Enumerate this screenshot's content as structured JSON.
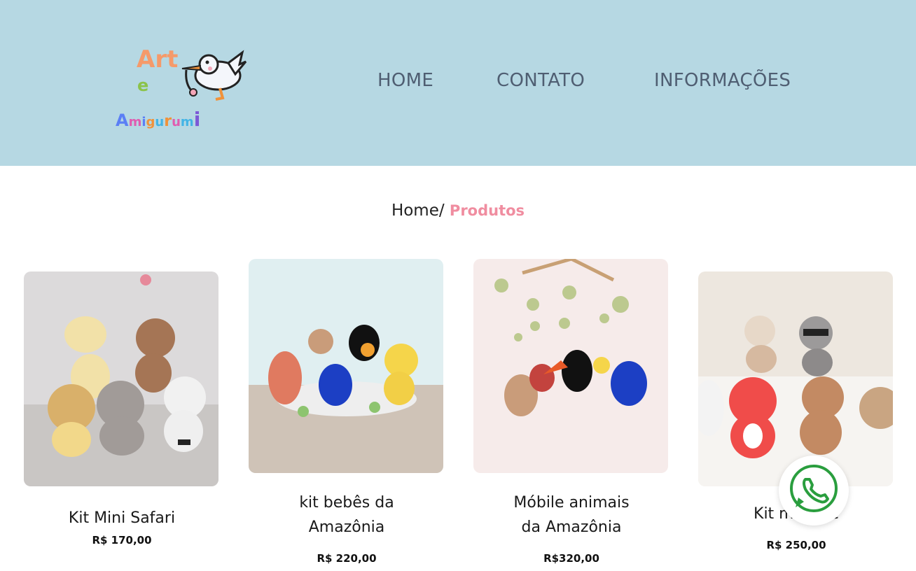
{
  "logo": {
    "text": "Art e Amigurumi"
  },
  "nav": {
    "items": [
      {
        "label": "HOME"
      },
      {
        "label": "CONTATO"
      },
      {
        "label": "INFORMAÇÕES"
      }
    ]
  },
  "breadcrumb": {
    "home": "Home/",
    "current": "Produtos"
  },
  "products": [
    {
      "title": "Kit Mini Safari",
      "price": "R$ 170,00"
    },
    {
      "title_line1": "kit bebês da",
      "title_line2": "Amazônia",
      "price": "R$ 220,00"
    },
    {
      "title_line1": "Móbile animais",
      "title_line2": "da Amazônia",
      "price": "R$320,00"
    },
    {
      "title_visible": "Kit mi … ue",
      "price": "R$ 250,00"
    }
  ],
  "whatsapp": {
    "icon": "whatsapp-icon"
  },
  "colors": {
    "header_bg": "#b6d8e3",
    "nav_text": "#4f5e72",
    "breadcrumb_active": "#f08da0"
  }
}
